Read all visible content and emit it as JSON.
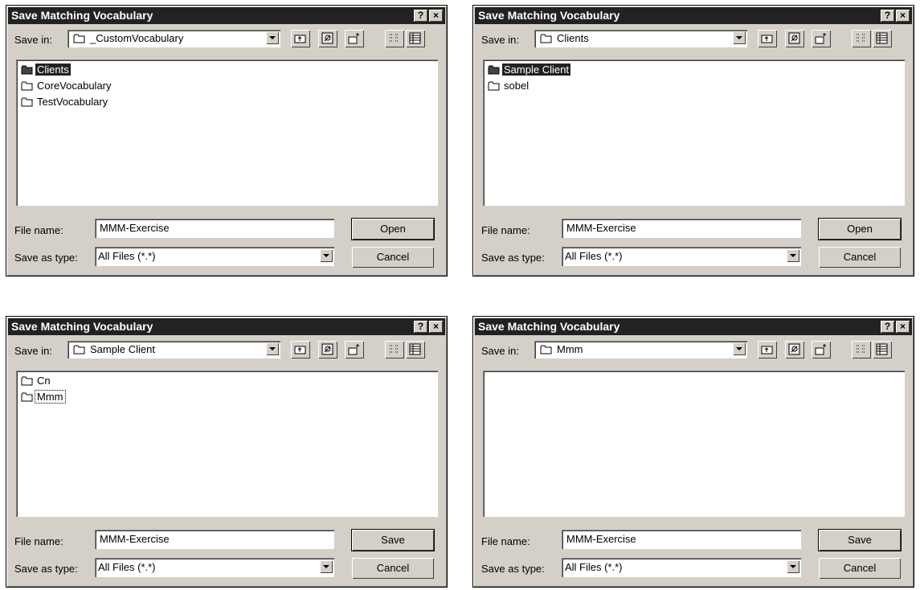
{
  "dialogs": [
    {
      "title": "Save Matching Vocabulary",
      "help_label": "?",
      "close_label": "×",
      "save_in_label": "Save in:",
      "save_in_value": "_CustomVocabulary",
      "items": [
        {
          "label": "Clients",
          "selected": true
        },
        {
          "label": "CoreVocabulary",
          "selected": false
        },
        {
          "label": "TestVocabulary",
          "selected": false
        }
      ],
      "file_name_label": "File name:",
      "file_name_value": "MMM-Exercise",
      "save_as_type_label": "Save as type:",
      "save_as_type_value": "All Files (*.*)",
      "primary_button": "Open",
      "cancel_button": "Cancel"
    },
    {
      "title": "Save Matching Vocabulary",
      "help_label": "?",
      "close_label": "×",
      "save_in_label": "Save in:",
      "save_in_value": "Clients",
      "items": [
        {
          "label": "Sample Client",
          "selected": true
        },
        {
          "label": "sobel",
          "selected": false
        }
      ],
      "file_name_label": "File name:",
      "file_name_value": "MMM-Exercise",
      "save_as_type_label": "Save as type:",
      "save_as_type_value": "All Files (*.*)",
      "primary_button": "Open",
      "cancel_button": "Cancel"
    },
    {
      "title": "Save Matching Vocabulary",
      "help_label": "?",
      "close_label": "×",
      "save_in_label": "Save in:",
      "save_in_value": "Sample Client",
      "items": [
        {
          "label": "Cn",
          "selected": false
        },
        {
          "label": "Mmm",
          "selected": false,
          "focused": true
        }
      ],
      "file_name_label": "File name:",
      "file_name_value": "MMM-Exercise",
      "save_as_type_label": "Save as type:",
      "save_as_type_value": "All Files (*.*)",
      "primary_button": "Save",
      "cancel_button": "Cancel"
    },
    {
      "title": "Save Matching Vocabulary",
      "help_label": "?",
      "close_label": "×",
      "save_in_label": "Save in:",
      "save_in_value": "Mmm",
      "items": [],
      "file_name_label": "File name:",
      "file_name_value": "MMM-Exercise",
      "save_as_type_label": "Save as type:",
      "save_as_type_value": "All Files (*.*)",
      "primary_button": "Save",
      "cancel_button": "Cancel"
    }
  ],
  "colors": {
    "dialog_face": "#d4d0c8",
    "titlebar": "#222222",
    "selection": "#222222"
  }
}
